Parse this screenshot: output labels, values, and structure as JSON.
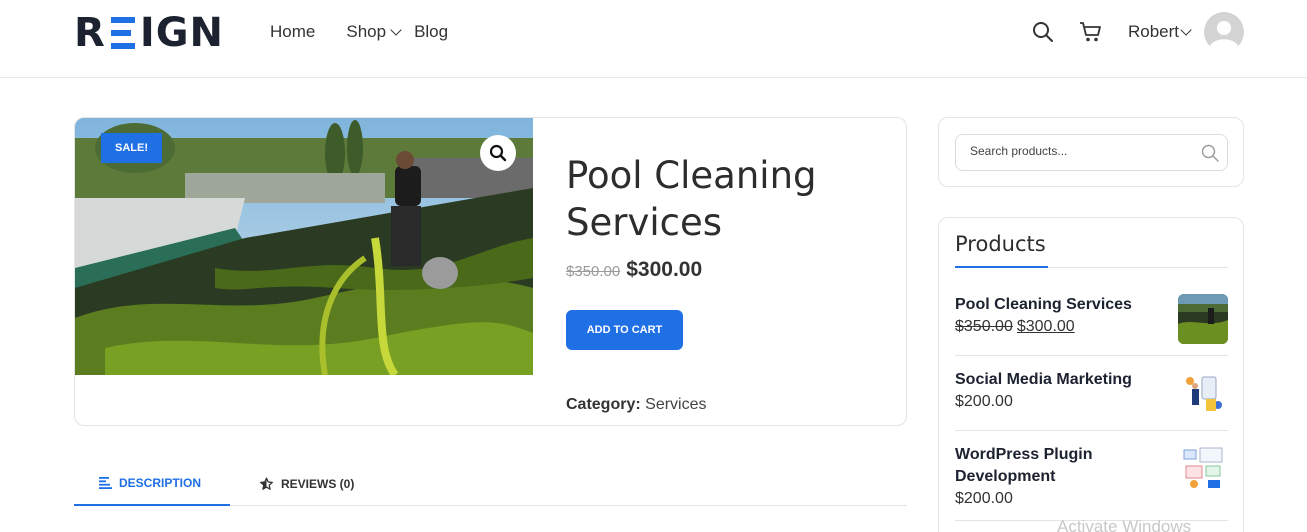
{
  "header": {
    "logo": {
      "left": "R",
      "right": "IGN"
    },
    "nav": [
      {
        "label": "Home"
      },
      {
        "label": "Shop"
      },
      {
        "label": "Blog"
      }
    ],
    "user_name": "Robert"
  },
  "product": {
    "badge": "SALE!",
    "title": "Pool Cleaning Services",
    "price_old": "$350.00",
    "price_new": "$300.00",
    "add_to_cart": "ADD TO CART",
    "category_label": "Category:",
    "category_value": "Services"
  },
  "tabs": [
    {
      "label": "DESCRIPTION",
      "active": true
    },
    {
      "label": "REVIEWS (0)",
      "active": false
    }
  ],
  "sidebar": {
    "search_placeholder": "Search products...",
    "products_title": "Products",
    "products": [
      {
        "name": "Pool Cleaning Services",
        "price_old": "$350.00",
        "price_new": "$300.00"
      },
      {
        "name": "Social Media Marketing",
        "price": "$200.00"
      },
      {
        "name": "WordPress Plugin Development",
        "price": "$200.00"
      }
    ]
  },
  "watermark": "Activate Windows",
  "colors": {
    "accent": "#1f6fe5",
    "text": "#2b2b2b",
    "border": "#e4e4e4"
  }
}
